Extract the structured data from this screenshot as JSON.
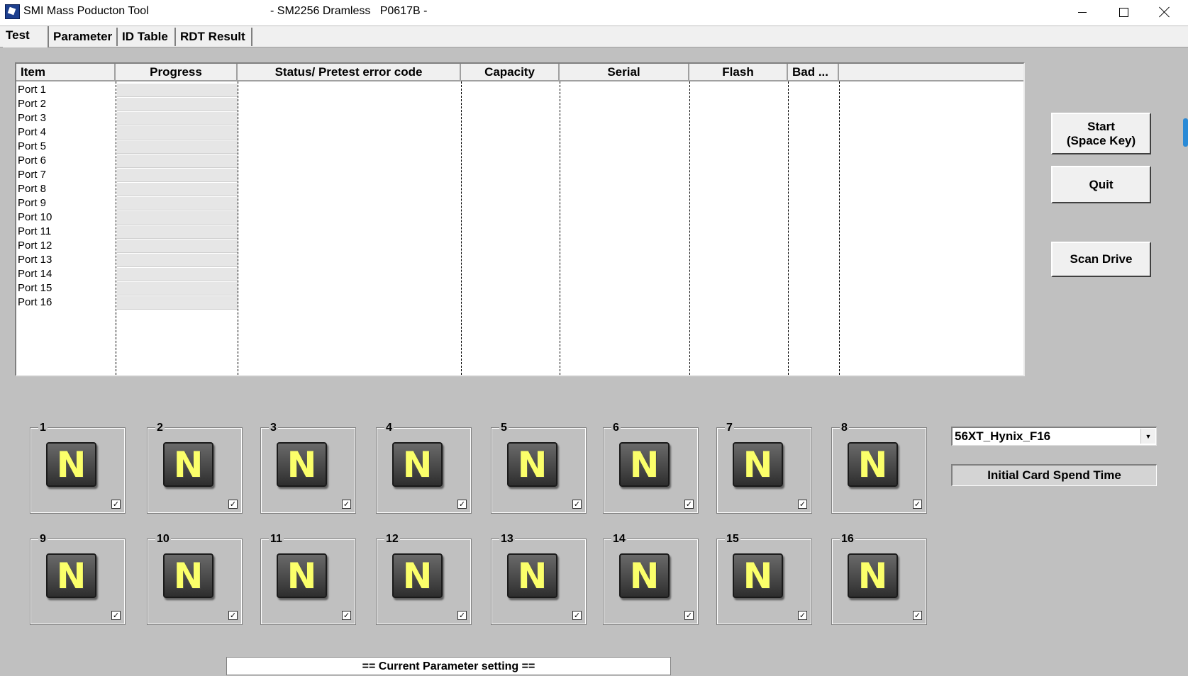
{
  "window": {
    "app_name": "SMI Mass Poducton Tool",
    "subtitle": "- SM2256 Dramless   P0617B -"
  },
  "tabs": [
    {
      "label": "Test",
      "active": true
    },
    {
      "label": "Parameter"
    },
    {
      "label": "ID Table"
    },
    {
      "label": "RDT Result"
    }
  ],
  "table": {
    "columns": [
      "Item",
      "Progress",
      "Status/ Pretest error code",
      "Capacity",
      "Serial",
      "Flash",
      "Bad ..."
    ],
    "rows": [
      {
        "item": "Port 1",
        "progress": 0
      },
      {
        "item": "Port 2",
        "progress": 0
      },
      {
        "item": "Port 3",
        "progress": 0
      },
      {
        "item": "Port 4",
        "progress": 0
      },
      {
        "item": "Port 5",
        "progress": 0
      },
      {
        "item": "Port 6",
        "progress": 0
      },
      {
        "item": "Port 7",
        "progress": 0
      },
      {
        "item": "Port 8",
        "progress": 0
      },
      {
        "item": "Port 9",
        "progress": 0
      },
      {
        "item": "Port 10",
        "progress": 0
      },
      {
        "item": "Port 11",
        "progress": 0
      },
      {
        "item": "Port 12",
        "progress": 0
      },
      {
        "item": "Port 13",
        "progress": 0
      },
      {
        "item": "Port 14",
        "progress": 0
      },
      {
        "item": "Port 15",
        "progress": 0
      },
      {
        "item": "Port 16",
        "progress": 0
      }
    ]
  },
  "buttons": {
    "start": "Start\n(Space Key)",
    "quit": "Quit",
    "scan": "Scan Drive"
  },
  "ports": [
    {
      "num": "1",
      "state": "N",
      "checked": true
    },
    {
      "num": "2",
      "state": "N",
      "checked": true
    },
    {
      "num": "3",
      "state": "N",
      "checked": true
    },
    {
      "num": "4",
      "state": "N",
      "checked": true
    },
    {
      "num": "5",
      "state": "N",
      "checked": true
    },
    {
      "num": "6",
      "state": "N",
      "checked": true
    },
    {
      "num": "7",
      "state": "N",
      "checked": true
    },
    {
      "num": "8",
      "state": "N",
      "checked": true
    },
    {
      "num": "9",
      "state": "N",
      "checked": true
    },
    {
      "num": "10",
      "state": "N",
      "checked": true
    },
    {
      "num": "11",
      "state": "N",
      "checked": true
    },
    {
      "num": "12",
      "state": "N",
      "checked": true
    },
    {
      "num": "13",
      "state": "N",
      "checked": true
    },
    {
      "num": "14",
      "state": "N",
      "checked": true
    },
    {
      "num": "15",
      "state": "N",
      "checked": true
    },
    {
      "num": "16",
      "state": "N",
      "checked": true
    }
  ],
  "flash_select": {
    "value": "56XT_Hynix_F16"
  },
  "spend_label": "Initial Card Spend Time",
  "param_header": "== Current Parameter setting ==",
  "colors": {
    "background": "#c0c0c0",
    "n_icon_text": "#fbff6a",
    "n_icon_bg": "#3a3a3a"
  },
  "icons": {
    "app": "smi-app-icon",
    "minimize": "minimize-icon",
    "maximize": "maximize-icon",
    "close": "close-icon",
    "port_status": "n-status-icon",
    "checkbox": "checkmark-icon",
    "dropdown": "chevron-down-icon"
  }
}
